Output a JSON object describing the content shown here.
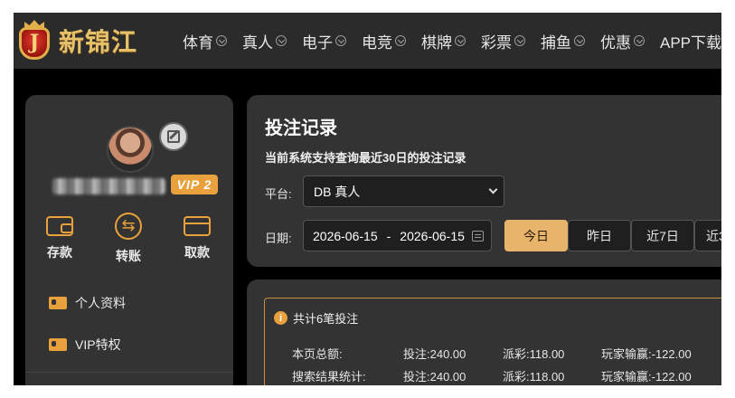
{
  "brand": {
    "logo_letter": "J",
    "name": "新锦江"
  },
  "nav": [
    "体育",
    "真人",
    "电子",
    "电竞",
    "棋牌",
    "彩票",
    "捕鱼",
    "优惠",
    "APP下载"
  ],
  "sidebar": {
    "vip_badge": "VIP 2",
    "actions": [
      {
        "label": "存款",
        "icon": "wallet-icon"
      },
      {
        "label": "转账",
        "icon": "transfer-icon"
      },
      {
        "label": "取款",
        "icon": "card-icon"
      }
    ],
    "menu": [
      {
        "label": "个人资料",
        "icon": "profile-card-icon"
      },
      {
        "label": "VIP特权",
        "icon": "vip-card-icon"
      }
    ]
  },
  "bet_records": {
    "title": "投注记录",
    "description": "当前系统支持查询最近30日的投注记录",
    "platform_label": "平台:",
    "platform_value": "DB 真人",
    "date_label": "日期:",
    "date_start": "2026-06-15",
    "date_sep": "-",
    "date_end": "2026-06-15",
    "quick_ranges": [
      "今日",
      "昨日",
      "近7日",
      "近3"
    ],
    "active_range": "今日"
  },
  "summary": {
    "header": "共计6笔投注",
    "rows": [
      {
        "label": "本页总额:",
        "bet": "投注:240.00",
        "payout": "派彩:118.00",
        "winloss": "玩家输赢:-122.00"
      },
      {
        "label": "搜索结果统计:",
        "bet": "投注:240.00",
        "payout": "派彩:118.00",
        "winloss": "玩家输赢:-122.00"
      }
    ]
  },
  "colors": {
    "accent": "#e8a13c",
    "active_button": "#e8b36a",
    "panel": "#333333",
    "topbar": "#2b2b2b"
  }
}
